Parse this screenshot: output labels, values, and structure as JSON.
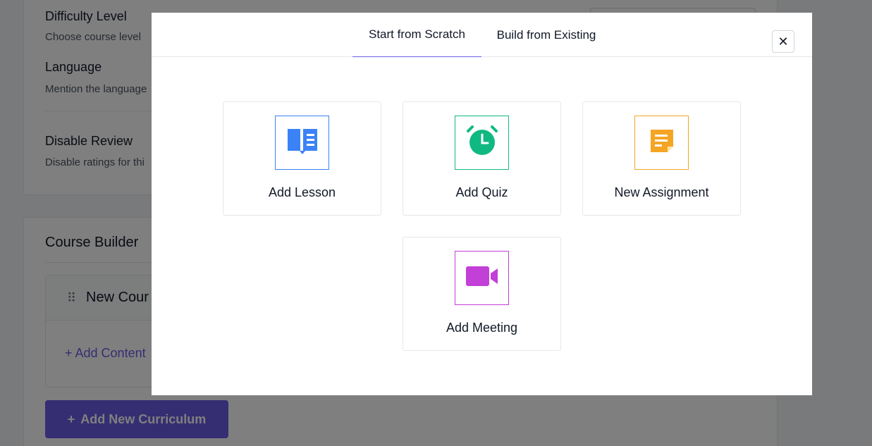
{
  "background": {
    "settings": [
      {
        "title": "Difficulty Level",
        "description": "Choose course level"
      },
      {
        "title": "Language",
        "description": "Mention the language"
      },
      {
        "title": "Disable Review",
        "description": "Disable ratings for thi"
      }
    ],
    "builder": {
      "title": "Course Builder",
      "topic_title": "New Cour",
      "add_content": "+ Add Content",
      "add_curriculum_icon": "+",
      "add_curriculum_label": "Add New Curriculum"
    }
  },
  "modal": {
    "tabs": [
      {
        "label": "Start from Scratch",
        "active": true
      },
      {
        "label": "Build from Existing",
        "active": false
      }
    ],
    "close_glyph": "✕",
    "options": [
      {
        "label": "Add Lesson",
        "icon": "book-icon",
        "color": "#3b82f6"
      },
      {
        "label": "Add Quiz",
        "icon": "alarm-clock-icon",
        "color": "#10b981"
      },
      {
        "label": "New Assignment",
        "icon": "note-icon",
        "color": "#f5a524"
      },
      {
        "label": "Add Meeting",
        "icon": "video-camera-icon",
        "color": "#c23fd8"
      }
    ]
  },
  "colors": {
    "accent": "#6b5ce7",
    "overlay": "rgba(0,0,0,0.5)"
  }
}
